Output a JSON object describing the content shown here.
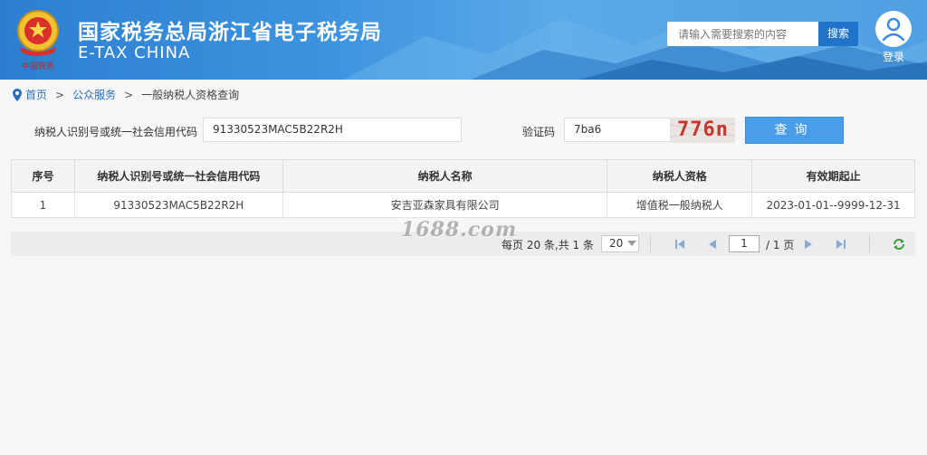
{
  "header": {
    "title_cn": "国家税务总局浙江省电子税务局",
    "title_en": "E-TAX CHINA",
    "search_placeholder": "请输入需要搜索的内容",
    "search_label": "搜索",
    "login_label": "登录"
  },
  "breadcrumb": {
    "home": "首页",
    "sep1": ">",
    "public": "公众服务",
    "sep2": ">",
    "current": "一般纳税人资格查询"
  },
  "form": {
    "taxid_label": "纳税人识别号或统一社会信用代码",
    "taxid_value": "91330523MAC5B22R2H",
    "captcha_label": "验证码",
    "captcha_value": "7ba6",
    "captcha_image_text": "776n",
    "query_label": "查询"
  },
  "table": {
    "headers": [
      "序号",
      "纳税人识别号或统一社会信用代码",
      "纳税人名称",
      "纳税人资格",
      "有效期起止"
    ],
    "rows": [
      [
        "1",
        "91330523MAC5B22R2H",
        "安吉亚森家具有限公司",
        "增值税一般纳税人",
        "2023-01-01--9999-12-31"
      ]
    ]
  },
  "pager": {
    "info": "每页 20 条,共 1 条",
    "page_size": "20",
    "current_page": "1",
    "total_pages": "/ 1 页"
  },
  "watermark": "1688.com",
  "colors": {
    "header_blue": "#3d93df",
    "button_blue": "#4a9ee8",
    "link_blue": "#2a6fb8",
    "captcha_red": "#c0392b"
  }
}
